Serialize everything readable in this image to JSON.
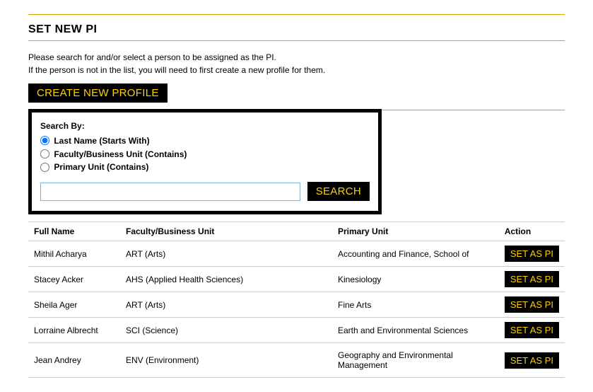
{
  "page_title": "SET NEW PI",
  "instructions_line1": "Please search for and/or select a person to be assigned as the PI.",
  "instructions_line2": "If the person is not in the list, you will need to first create a new profile for them.",
  "create_profile_label": "CREATE NEW PROFILE",
  "search": {
    "heading": "Search By:",
    "options": [
      {
        "label": "Last Name (Starts With)",
        "checked": true
      },
      {
        "label": "Faculty/Business Unit (Contains)",
        "checked": false
      },
      {
        "label": "Primary Unit (Contains)",
        "checked": false
      }
    ],
    "input_value": "",
    "button_label": "SEARCH"
  },
  "table": {
    "headers": {
      "full_name": "Full Name",
      "faculty": "Faculty/Business Unit",
      "primary": "Primary Unit",
      "action": "Action"
    },
    "action_label": "SET AS PI",
    "rows": [
      {
        "full_name": "Mithil Acharya",
        "faculty": "ART (Arts)",
        "primary": "Accounting and Finance, School of"
      },
      {
        "full_name": "Stacey Acker",
        "faculty": "AHS (Applied Health Sciences)",
        "primary": "Kinesiology"
      },
      {
        "full_name": "Sheila Ager",
        "faculty": "ART (Arts)",
        "primary": "Fine Arts"
      },
      {
        "full_name": "Lorraine Albrecht",
        "faculty": "SCI (Science)",
        "primary": "Earth and Environmental Sciences"
      },
      {
        "full_name": "Jean Andrey",
        "faculty": "ENV (Environment)",
        "primary": "Geography and Environmental Management"
      }
    ]
  }
}
